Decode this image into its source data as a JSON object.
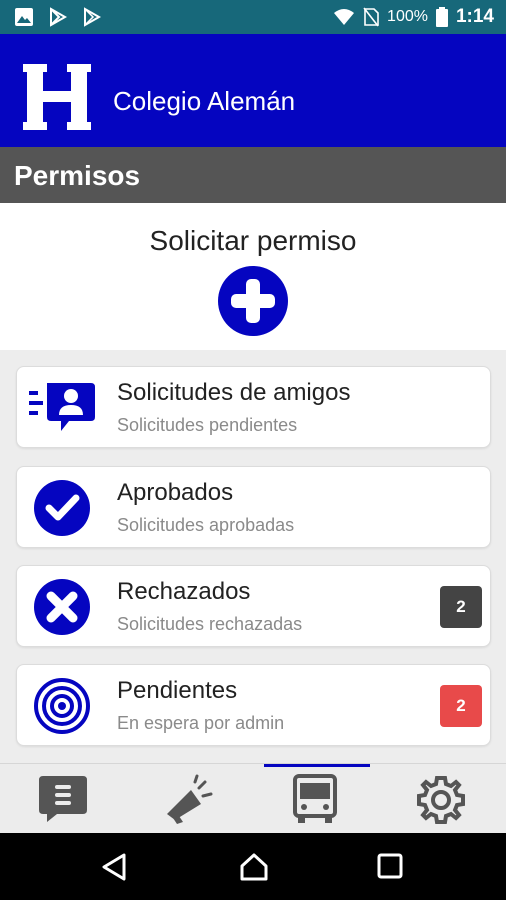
{
  "status_bar": {
    "battery": "100%",
    "time": "1:14",
    "icons": [
      "image-icon",
      "play-store-icon",
      "play-store-outline-icon",
      "wifi-icon",
      "no-sim-icon",
      "battery-icon"
    ]
  },
  "app": {
    "logo_letter": "H",
    "title": "Colegio Alemán",
    "brand_color": "#0505c0"
  },
  "section": {
    "title": "Permisos"
  },
  "request": {
    "label": "Solicitar permiso",
    "icon": "plus-circle-icon"
  },
  "cards": [
    {
      "title": "Solicitudes de amigos",
      "subtitle": "Solicitudes pendientes",
      "icon": "friend-request-icon",
      "badge": null
    },
    {
      "title": "Aprobados",
      "subtitle": "Solicitudes aprobadas",
      "icon": "check-circle-icon",
      "badge": null
    },
    {
      "title": "Rechazados",
      "subtitle": "Solicitudes rechazadas",
      "icon": "x-circle-icon",
      "badge": "2",
      "badge_color": "#444444"
    },
    {
      "title": "Pendientes",
      "subtitle": "En espera por admin",
      "icon": "target-icon",
      "badge": "2",
      "badge_color": "#e84a4a"
    }
  ],
  "bottom_nav": {
    "items": [
      "chat-icon",
      "megaphone-icon",
      "bus-icon",
      "settings-icon"
    ],
    "active": "bus-icon"
  },
  "system_nav": [
    "back-icon",
    "home-icon",
    "recents-icon"
  ]
}
